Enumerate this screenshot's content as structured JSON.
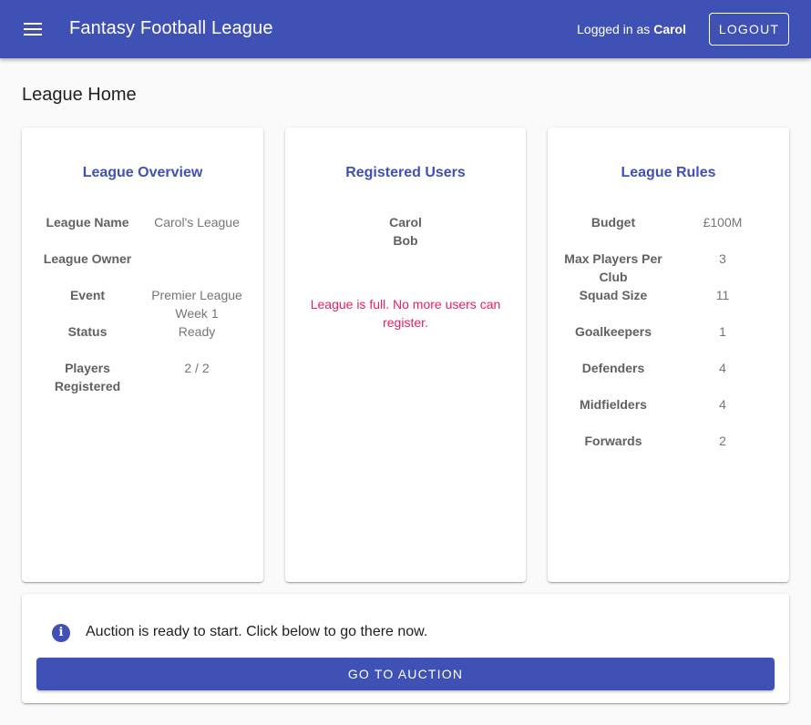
{
  "header": {
    "title": "Fantasy Football League",
    "logged_in_prefix": "Logged in as",
    "username": "Carol",
    "logout_label": "LOGOUT",
    "color": "#3f51b5"
  },
  "page": {
    "title": "League Home"
  },
  "overview": {
    "title": "League Overview",
    "rows": [
      {
        "key": "League Name",
        "value": "Carol's League"
      },
      {
        "key": "League Owner",
        "value": ""
      },
      {
        "key": "Event",
        "value": "Premier League Week 1"
      },
      {
        "key": "Status",
        "value": "Ready"
      },
      {
        "key": "Players Registered",
        "value": "2 / 2"
      }
    ]
  },
  "users": {
    "title": "Registered Users",
    "list": [
      "Carol",
      "Bob"
    ],
    "full_message": "League is full. No more users can register.",
    "message_color": "#e91e63"
  },
  "rules": {
    "title": "League Rules",
    "rows": [
      {
        "key": "Budget",
        "value": "£100M"
      },
      {
        "key": "Max Players Per Club",
        "value": "3"
      },
      {
        "key": "Squad Size",
        "value": "11"
      },
      {
        "key": "Goalkeepers",
        "value": "1"
      },
      {
        "key": "Defenders",
        "value": "4"
      },
      {
        "key": "Midfielders",
        "value": "4"
      },
      {
        "key": "Forwards",
        "value": "2"
      }
    ]
  },
  "auction": {
    "icon": "info-icon",
    "message": "Auction is ready to start. Click below to go there now.",
    "button_label": "GO TO AUCTION"
  }
}
